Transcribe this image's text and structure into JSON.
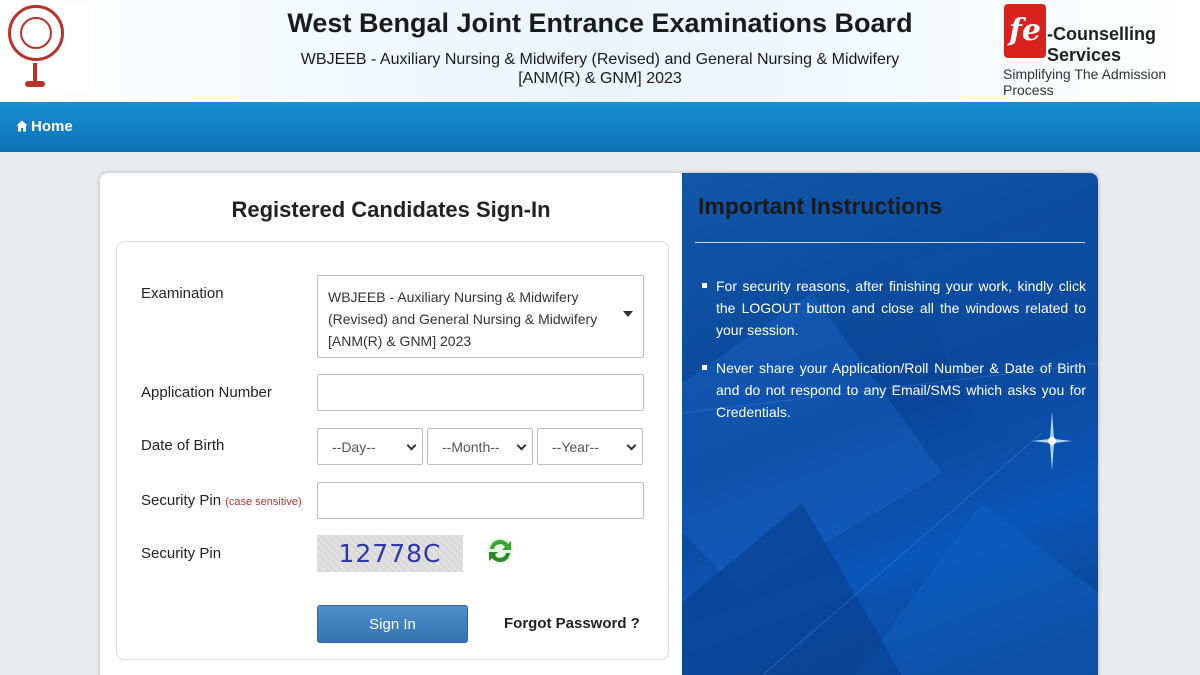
{
  "header": {
    "title": "West Bengal Joint Entrance Examinations Board",
    "subtitle_line1": "WBJEEB - Auxiliary Nursing & Midwifery (Revised) and General Nursing & Midwifery",
    "subtitle_line2": "[ANM(R) & GNM] 2023",
    "logo_right_text": "-Counselling Services",
    "logo_right_tagline": "Simplifying The Admission Process"
  },
  "nav": {
    "home_label": "Home"
  },
  "signin": {
    "title": "Registered Candidates Sign-In",
    "exam_label": "Examination",
    "exam_value": "WBJEEB - Auxiliary Nursing & Midwifery (Revised) and General Nursing & Midwifery [ANM(R) & GNM] 2023",
    "app_label": "Application Number",
    "app_value": "",
    "dob_label": "Date of Birth",
    "dob_day": "--Day--",
    "dob_month": "--Month--",
    "dob_year": "--Year--",
    "pin_label": "Security Pin",
    "pin_note": "(case sensitive)",
    "pin_value": "",
    "captcha_label": "Security Pin",
    "captcha_text": "12778C",
    "signin_button": "Sign In",
    "forgot_link": "Forgot Password ?"
  },
  "instructions": {
    "title": "Important Instructions",
    "items": [
      "For security reasons, after finishing your work, kindly click the LOGOUT button and close all the windows related to your session.",
      "Never share your Application/Roll Number & Date of Birth and do not respond to any Email/SMS which asks you for Credentials."
    ]
  },
  "icons": {
    "home": "home-icon",
    "refresh": "refresh-icon",
    "dropdown": "chevron-down-icon"
  },
  "colors": {
    "nav": "#0a73b6",
    "button": "#3574b3",
    "panel": "#0a4598",
    "brand_red": "#d9211d"
  }
}
